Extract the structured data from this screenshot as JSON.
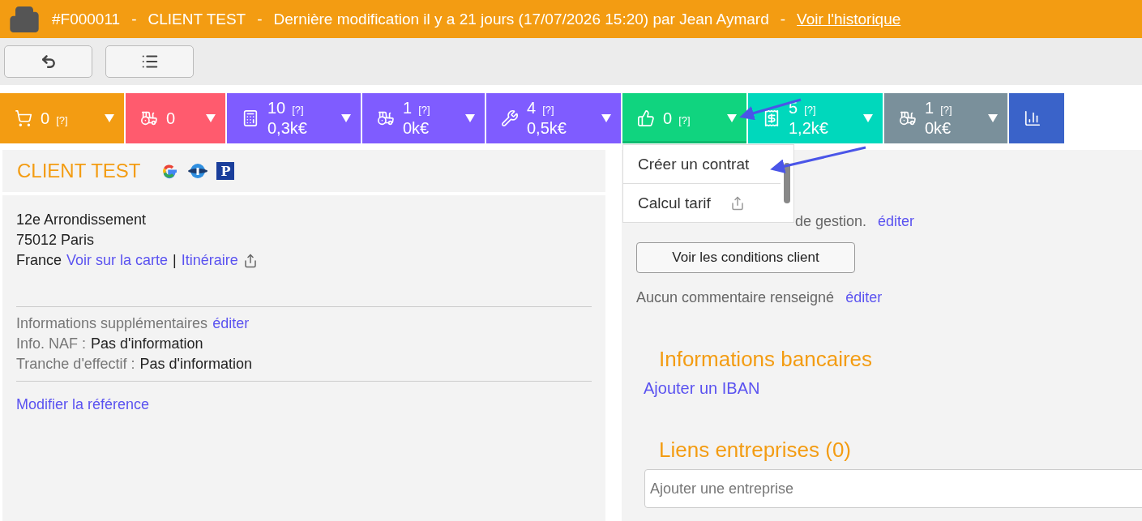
{
  "header": {
    "reference": "#F000011",
    "separator_1": "-",
    "client": "CLIENT TEST",
    "separator_2": "-",
    "modification": "Dernière modification il y a 21 jours (17/07/2026 15:20) par Jean Aymard",
    "separator_3": "-",
    "history_link": "Voir l'historique"
  },
  "tiles": [
    {
      "kind": "cart",
      "color": "#f39c12",
      "count": "0",
      "help": "[?]",
      "expanded": false
    },
    {
      "kind": "tractor",
      "color": "#ff5b6e",
      "count": "0",
      "expanded": false
    },
    {
      "kind": "calculator",
      "color": "#7f5cff",
      "count": "10",
      "help": "[?]",
      "amount": "0,3k€",
      "expanded": false
    },
    {
      "kind": "tractor",
      "color": "#7f5cff",
      "count": "1",
      "help": "[?]",
      "amount": "0k€",
      "expanded": false
    },
    {
      "kind": "tools",
      "color": "#7f5cff",
      "count": "4",
      "help": "[?]",
      "amount": "0,5k€",
      "expanded": false
    },
    {
      "kind": "contract",
      "color": "#10d47f",
      "count": "0",
      "help": "[?]",
      "expanded": true,
      "menu": [
        {
          "label": "Créer un contrat",
          "share": false
        },
        {
          "label": "Calcul tarif",
          "share": true
        }
      ]
    },
    {
      "kind": "invoice",
      "color": "#00d8bc",
      "count": "5",
      "help": "[?]",
      "amount": "1,2k€",
      "expanded": false
    },
    {
      "kind": "tractor",
      "color": "#7a909b",
      "count": "1",
      "help": "[?]",
      "amount": "0k€",
      "expanded": false
    },
    {
      "kind": "chart",
      "color": "#3a63c9"
    }
  ],
  "client_card": {
    "title": "CLIENT TEST",
    "badge_letter": "P",
    "address": [
      "12e Arrondissement",
      "75012 Paris"
    ],
    "country": "France",
    "map_link": "Voir sur la carte",
    "link_separator": "|",
    "route_link": "Itinéraire",
    "extra_label": "Informations supplémentaires",
    "extra_edit": "éditer",
    "fields": [
      {
        "label": "Info. NAF :",
        "value": "Pas d'information"
      },
      {
        "label": "Tranche d'effectif :",
        "value": "Pas d'information"
      }
    ],
    "reference_link": "Modifier la référence"
  },
  "management": {
    "text": "de gestion.",
    "edit": "éditer",
    "conditions_button": "Voir les conditions client",
    "comment": "Aucun commentaire renseigné",
    "comment_edit": "éditer"
  },
  "bank": {
    "title": "Informations bancaires",
    "add_link": "Ajouter un IBAN"
  },
  "companies": {
    "title": "Liens entreprises (0)",
    "placeholder": "Ajouter une entreprise"
  }
}
